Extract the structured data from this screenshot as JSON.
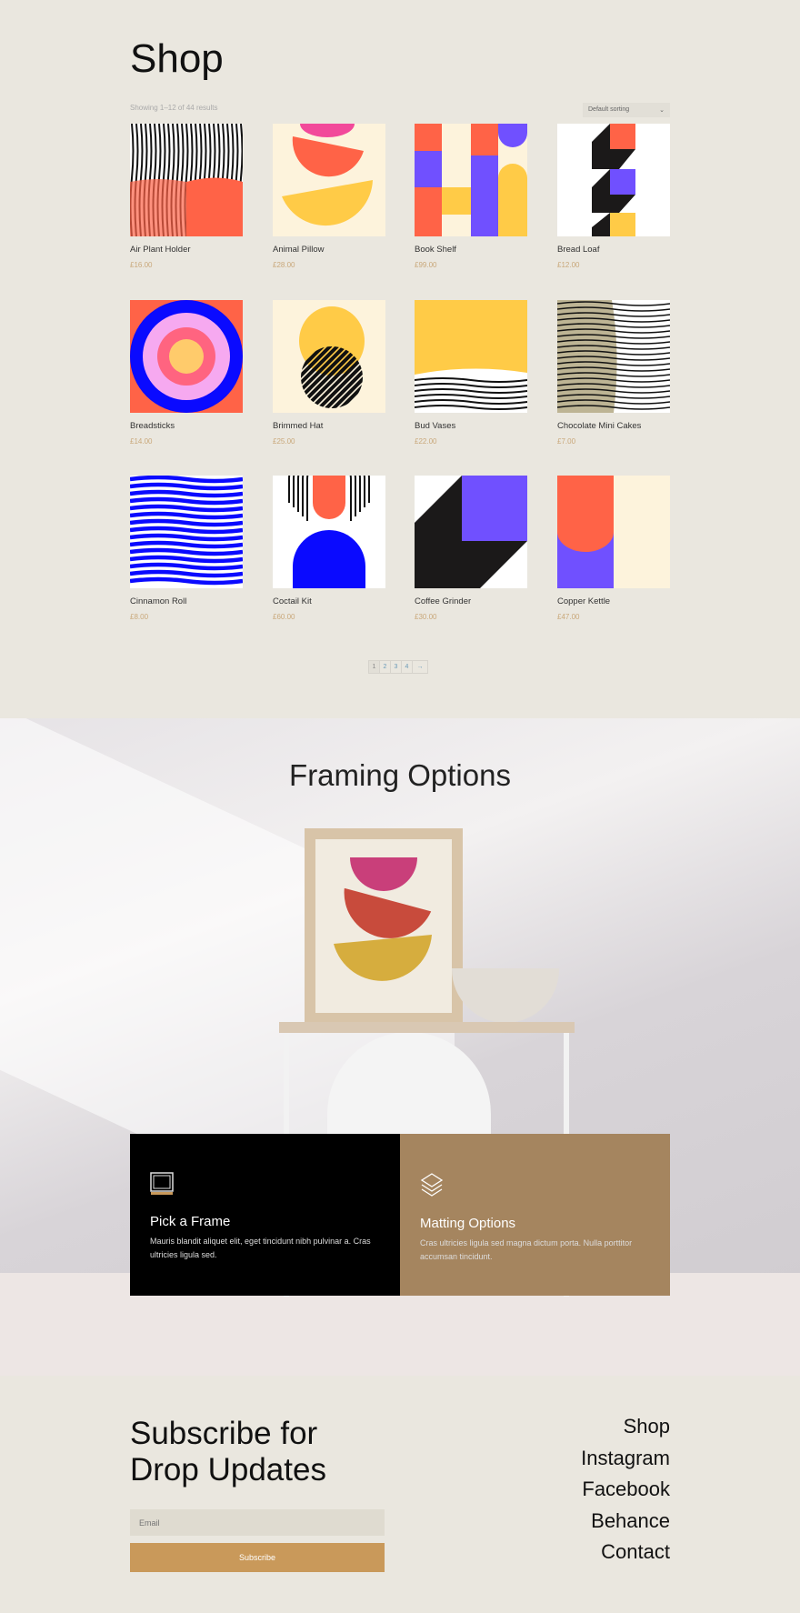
{
  "shop": {
    "title": "Shop",
    "result_count": "Showing 1–12 of 44 results",
    "sort": {
      "selected": "Default sorting",
      "icon": "chevron-down-icon"
    },
    "products": [
      {
        "name": "Air Plant Holder",
        "price": "£16.00",
        "art": "waves-orange"
      },
      {
        "name": "Animal Pillow",
        "price": "£28.00",
        "art": "half-circles"
      },
      {
        "name": "Book Shelf",
        "price": "£99.00",
        "art": "columns"
      },
      {
        "name": "Bread Loaf",
        "price": "£12.00",
        "art": "zigzag"
      },
      {
        "name": "Breadsticks",
        "price": "£14.00",
        "art": "target"
      },
      {
        "name": "Brimmed Hat",
        "price": "£25.00",
        "art": "blob-stripes"
      },
      {
        "name": "Bud Vases",
        "price": "£22.00",
        "art": "yellow-waves"
      },
      {
        "name": "Chocolate Mini Cakes",
        "price": "£7.00",
        "art": "beige-waves"
      },
      {
        "name": "Cinnamon Roll",
        "price": "£8.00",
        "art": "blue-waves"
      },
      {
        "name": "Coctail Kit",
        "price": "£60.00",
        "art": "arches"
      },
      {
        "name": "Coffee Grinder",
        "price": "£30.00",
        "art": "diagonal"
      },
      {
        "name": "Copper Kettle",
        "price": "£47.00",
        "art": "kettle"
      }
    ],
    "pagination": [
      "1",
      "2",
      "3",
      "4",
      "→"
    ],
    "current_page": "1"
  },
  "framing": {
    "title": "Framing Options",
    "features": [
      {
        "title": "Pick a Frame",
        "text": "Mauris blandit aliquet elit, eget tincidunt nibh pulvinar a. Cras ultricies ligula sed.",
        "icon": "frame-icon"
      },
      {
        "title": "Matting Options",
        "text": "Cras ultricies ligula sed magna dictum porta. Nulla porttitor accumsan tincidunt.",
        "icon": "layers-icon"
      }
    ]
  },
  "footer": {
    "subscribe_line1": "Subscribe for",
    "subscribe_line2": "Drop Updates",
    "email_placeholder": "Email",
    "subscribe_label": "Subscribe",
    "links": [
      "Shop",
      "Instagram",
      "Facebook",
      "Behance",
      "Contact"
    ]
  },
  "colors": {
    "background": "#eae7df",
    "accent": "#c9995a",
    "price": "#c9a87a",
    "matting_card": "#a5855f"
  }
}
